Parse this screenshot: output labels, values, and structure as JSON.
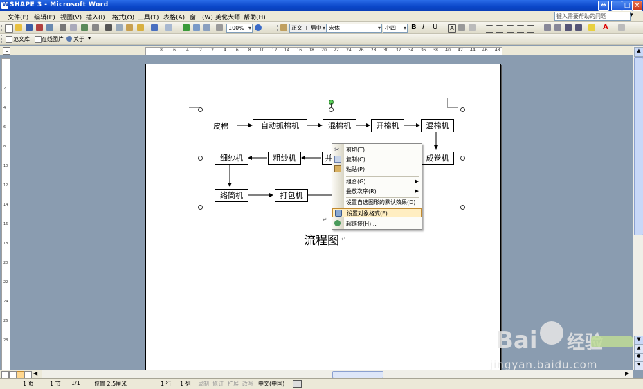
{
  "window": {
    "title": "SHAPE 3 - Microsoft Word"
  },
  "menu": [
    "文件(F)",
    "编辑(E)",
    "视图(V)",
    "插入(I)",
    "格式(O)",
    "工具(T)",
    "表格(A)",
    "窗口(W)",
    "美化大师",
    "帮助(H)"
  ],
  "help_placeholder": "键入需要帮助的问题",
  "toolbar": {
    "zoom": "100%",
    "style": "正文 + 居中",
    "font": "宋体",
    "size": "小四"
  },
  "toolbar2": {
    "gallery": "范文库",
    "online_images": "在线图片",
    "about": "关于"
  },
  "ruler_numbers": [
    "8",
    "6",
    "4",
    "2",
    "2",
    "4",
    "6",
    "8",
    "10",
    "12",
    "14",
    "16",
    "18",
    "20",
    "22",
    "24",
    "26",
    "28",
    "30",
    "32",
    "34",
    "36",
    "38",
    "40",
    "42",
    "44",
    "46",
    "48"
  ],
  "vruler_numbers": [
    "2",
    "4",
    "6",
    "8",
    "10",
    "12",
    "14",
    "16",
    "18",
    "20",
    "22",
    "24",
    "26",
    "28"
  ],
  "flowchart": {
    "start": "皮棉",
    "row1": [
      "自动抓棉机",
      "混棉机",
      "开棉机",
      "混棉机"
    ],
    "row2": [
      "细纱机",
      "粗纱机",
      "并",
      "成卷机"
    ],
    "row3": [
      "络筒机",
      "打包机"
    ],
    "caption": "流程图"
  },
  "context_menu": [
    {
      "label": "剪切(T)"
    },
    {
      "label": "复制(C)"
    },
    {
      "label": "粘贴(P)"
    },
    {
      "label": "组合(G)"
    },
    {
      "label": "叠放次序(R)"
    },
    {
      "label": "设置自选图形的默认效果(D)"
    },
    {
      "label": "设置对象格式(F)..."
    },
    {
      "label": "超链接(H)..."
    }
  ],
  "status": {
    "page": "1 页",
    "section": "1 节",
    "pages": "1/1",
    "position": "位置 2.5厘米",
    "line": "1 行",
    "col": "1 列",
    "rec": "录制",
    "trk": "修订",
    "ext": "扩展",
    "ovr": "改写",
    "lang": "中文(中国)"
  },
  "watermark": {
    "brand": "Bai",
    "brand_cn": "经验",
    "url": "jingyan.baidu.com"
  }
}
